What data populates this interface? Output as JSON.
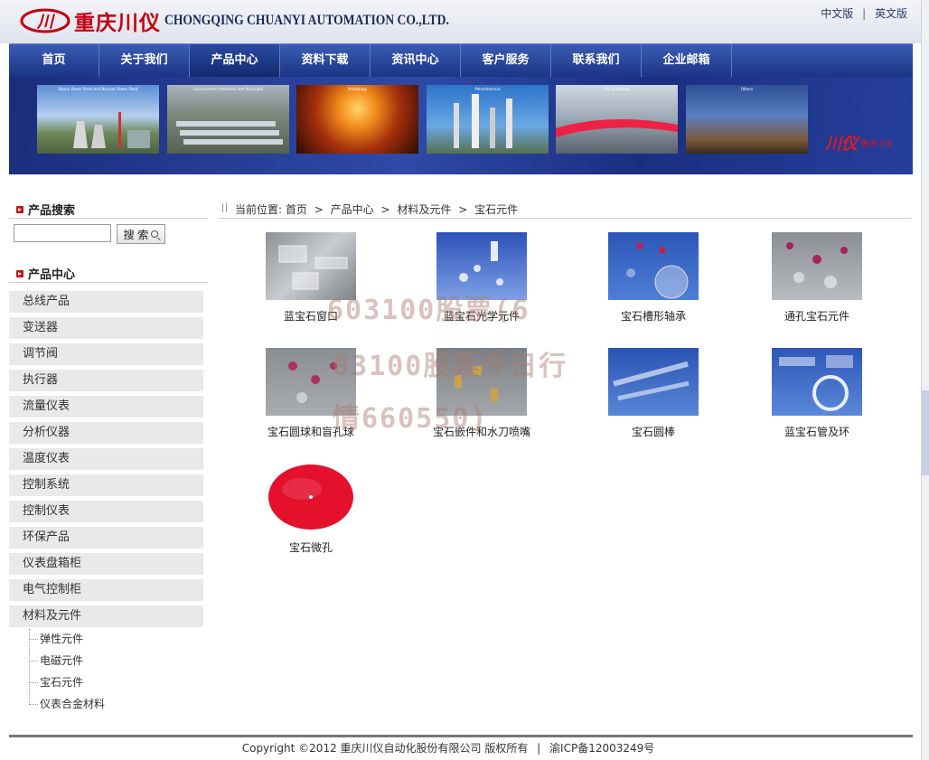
{
  "header": {
    "logo_cn": "重庆川仪",
    "logo_en": "CHONGQING CHUANYI AUTOMATION CO.,LTD.",
    "lang_cn": "中文版",
    "lang_sep": "|",
    "lang_en": "英文版"
  },
  "nav": [
    "首页",
    "关于我们",
    "产品中心",
    "资料下载",
    "资讯中心",
    "客户服务",
    "联系我们",
    "企业邮箱"
  ],
  "banner": {
    "photos": [
      {
        "caption": "Steam Power Plant And Nuclear Power Plant"
      },
      {
        "caption": "Environment Protection And Municipal"
      },
      {
        "caption": "Metallurgy"
      },
      {
        "caption": "Petrochemical"
      },
      {
        "caption": "City & Railway"
      },
      {
        "caption": "Others"
      }
    ],
    "brand_mark": "川仪",
    "brand_text": "重庆川仪"
  },
  "sidebar": {
    "search_title": "产品搜索",
    "search_input_value": "",
    "search_button": "搜 索",
    "catalog_title": "产品中心",
    "categories": [
      "总线产品",
      "变送器",
      "调节阀",
      "执行器",
      "流量仪表",
      "分析仪器",
      "温度仪表",
      "控制系统",
      "控制仪表",
      "环保产品",
      "仪表盘箱柜",
      "电气控制柜",
      "材料及元件"
    ],
    "subcategories": [
      "弹性元件",
      "电磁元件",
      "宝石元件",
      "仪表合金材料"
    ]
  },
  "breadcrumb": {
    "prefix": "当前位置:",
    "items": [
      "首页",
      "产品中心",
      "材料及元件",
      "宝石元件"
    ],
    "sep": ">"
  },
  "products": [
    "蓝宝石窗口",
    "蓝宝石光学元件",
    "宝石槽形轴承",
    "通孔宝石元件",
    "宝石圆球和盲孔球",
    "宝石嵌件和水刀喷嘴",
    "宝石圆棒",
    "蓝宝石管及环",
    "宝石微孔"
  ],
  "watermark": {
    "line1": "603100股票(6",
    "line2": "03100股票今日行",
    "line3": "情660550)"
  },
  "footer": {
    "copyright": "Copyright ©2012 重庆川仪自动化股份有限公司  版权所有",
    "sep": "|",
    "icp": "渝ICP备12003249号"
  },
  "colors": {
    "nav_blue": "#1c3585",
    "brand_red": "#c40012",
    "category_bg": "#e9e9e9"
  }
}
